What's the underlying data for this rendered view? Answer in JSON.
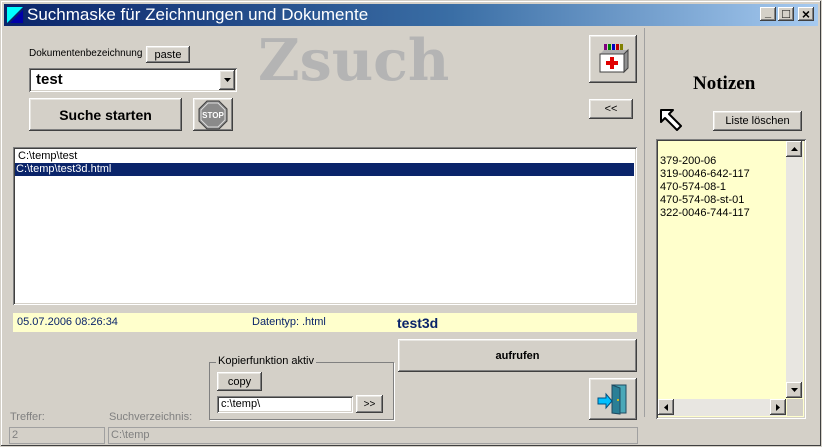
{
  "window": {
    "title": "Suchmaske für Zeichnungen und Dokumente",
    "minimize": "_",
    "maximize": "□",
    "close": "×"
  },
  "logo": "Zsuch",
  "search": {
    "label": "Dokumentenbezeichnung",
    "paste_label": "paste",
    "value": "test",
    "start_label": "Suche starten",
    "stop_label": "STOP"
  },
  "collapse_label": "<<",
  "results": [
    "C:\\temp\\test",
    "C:\\temp\\test3d.html"
  ],
  "selected_index": 1,
  "info": {
    "date": "05.07.2006 08:26:34",
    "type_label": "Datentyp:",
    "type_value": ".html",
    "name": "test3d"
  },
  "open_label": "aufrufen",
  "copy": {
    "group_label": "Kopierfunktion aktiv",
    "copy_label": "copy",
    "path": "c:\\temp\\",
    "forward_label": ">>"
  },
  "footer": {
    "hits_label": "Treffer:",
    "hits_value": "2",
    "dir_label": "Suchverzeichnis:",
    "dir_value": "C:\\temp"
  },
  "notes": {
    "title": "Notizen",
    "clear_label": "Liste löschen",
    "items": [
      "379-200-06",
      "319-0046-642-117",
      "470-574-08-1",
      "470-574-08-st-01",
      "322-0046-744-117"
    ]
  },
  "colors": {
    "selection": "#0a246a",
    "info_bg": "#ffffcc",
    "notes_bg": "#ffffcc",
    "accent_text": "#0a246a",
    "logo_gray": "#b4b4b4"
  }
}
